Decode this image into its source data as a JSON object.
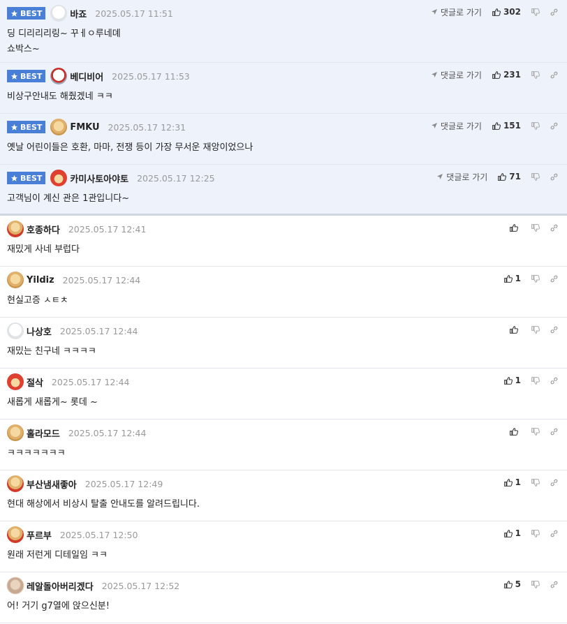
{
  "ui": {
    "best_label": "BEST",
    "reply_label": "댓글로 가기"
  },
  "comments": [
    {
      "best": true,
      "avatar": "white-dog",
      "nick": "바죠",
      "date": "2025.05.17 11:51",
      "body": "딩 디리리리링~ 꾸ㅔㅇ루네뎨\n쇼박스~",
      "likes": "302"
    },
    {
      "best": true,
      "avatar": "bedi",
      "nick": "베디비어",
      "date": "2025.05.17 11:53",
      "body": "비상구안내도 해줬겠네 ㅋㅋ",
      "likes": "231"
    },
    {
      "best": true,
      "avatar": "dog",
      "nick": "FMKU",
      "date": "2025.05.17 12:31",
      "body": "옛날 어린이들은 호환, 마마, 전쟁 등이 가장 무서운 재앙이었으나",
      "likes": "151"
    },
    {
      "best": true,
      "avatar": "santa",
      "nick": "카미사토아야토",
      "date": "2025.05.17 12:25",
      "body": "고객님이 계신 관은 1관입니다~",
      "likes": "71"
    },
    {
      "best": false,
      "avatar": "dog-red",
      "nick": "호종하다",
      "date": "2025.05.17 12:41",
      "body": "재밌게 사네 부럽다",
      "likes": ""
    },
    {
      "best": false,
      "avatar": "dog",
      "nick": "Yildiz",
      "date": "2025.05.17 12:44",
      "body": "현실고증 ㅅㅌㅊ",
      "likes": "1"
    },
    {
      "best": false,
      "avatar": "white-dog",
      "nick": "나상호",
      "date": "2025.05.17 12:44",
      "body": "재밌는 친구네 ㅋㅋㅋㅋ",
      "likes": ""
    },
    {
      "best": false,
      "avatar": "santa",
      "nick": "절삭",
      "date": "2025.05.17 12:44",
      "body": "새롭게 새롭게~ 롯데 ~",
      "likes": "1"
    },
    {
      "best": false,
      "avatar": "dog",
      "nick": "홀라모드",
      "date": "2025.05.17 12:44",
      "body": "ㅋㅋㅋㅋㅋㅋㅋ",
      "likes": ""
    },
    {
      "best": false,
      "avatar": "dog-red",
      "nick": "부산냄새좋아",
      "date": "2025.05.17 12:49",
      "body": "현대 해상에서 비상시 탈출 안내도를 알려드립니다.",
      "likes": "1"
    },
    {
      "best": false,
      "avatar": "dog-red",
      "nick": "푸르부",
      "date": "2025.05.17 12:50",
      "body": "원래 저런게 디테일임 ㅋㅋ",
      "likes": "1"
    },
    {
      "best": false,
      "avatar": "blur",
      "nick": "레알돌아버리겠다",
      "date": "2025.05.17 12:52",
      "body": "어! 거기 g7열에 앉으신분!",
      "likes": "5"
    }
  ],
  "colors": {
    "best_bg": "#eef3fb",
    "badge": "#4a7fd8",
    "date": "#999999"
  },
  "icons": [
    "star-icon",
    "arrow-icon",
    "thumbs-up-icon",
    "thumbs-down-icon",
    "link-icon"
  ]
}
